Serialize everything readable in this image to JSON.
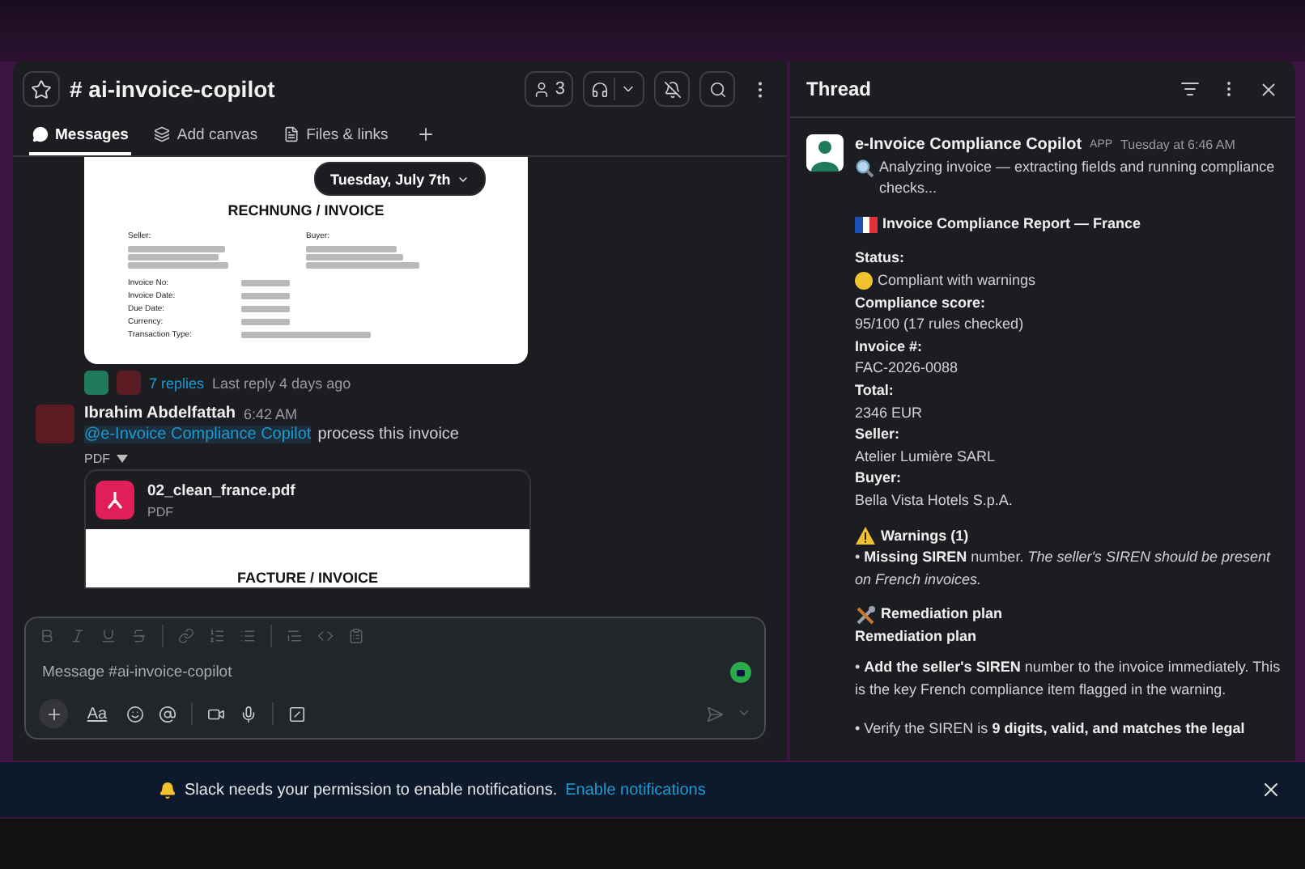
{
  "channel": {
    "title": "# ai-invoice-copilot",
    "member_count": "3"
  },
  "tabs": [
    {
      "label": "Messages",
      "selected": true,
      "kind": "messages"
    },
    {
      "label": "Add canvas",
      "selected": false,
      "kind": "canvas"
    },
    {
      "label": "Files & links",
      "selected": false,
      "kind": "files"
    }
  ],
  "date_divider": "Tuesday, July 7th",
  "invoice_preview": {
    "title": "RECHNUNG / INVOICE",
    "seller_label": "Seller:",
    "buyer_label": "Buyer:",
    "fields": [
      "Invoice No:",
      "Invoice Date:",
      "Due Date:",
      "Currency:",
      "Transaction Type:"
    ]
  },
  "thread_summary": {
    "replies": "7 replies",
    "last_reply": "Last reply 4 days ago"
  },
  "message": {
    "author": "Ibrahim Abdelfattah",
    "time": "6:42 AM",
    "mention": "@e-Invoice Compliance Copilot",
    "text": "process this invoice",
    "attachment_toggle": "PDF",
    "file": {
      "name": "02_clean_france.pdf",
      "type": "PDF",
      "preview_title": "FACTURE / INVOICE"
    }
  },
  "composer": {
    "placeholder": "Message #ai-invoice-copilot",
    "format_toggle": "Aa"
  },
  "thread": {
    "title": "Thread",
    "author": "e-Invoice Compliance Copilot",
    "badge": "APP",
    "time": "Tuesday at 6:46 AM",
    "blocks": [
      {
        "kind": "intro",
        "text": "Analyzing invoice — extracting fields and running compliance checks..."
      },
      {
        "kind": "report-heading",
        "text": "Invoice Compliance Report — France"
      },
      {
        "kind": "label",
        "text": "Status:"
      },
      {
        "kind": "status",
        "color": "#f2c12e",
        "text": "Compliant with warnings"
      },
      {
        "kind": "label",
        "text": "Compliance score:"
      },
      {
        "kind": "value",
        "text": "95/100 (17 rules checked)"
      },
      {
        "kind": "label",
        "text": "Invoice #:"
      },
      {
        "kind": "value",
        "text": "FAC-2026-0088"
      },
      {
        "kind": "label",
        "text": "Total:"
      },
      {
        "kind": "value",
        "text": "2346 EUR"
      },
      {
        "kind": "label",
        "text": "Seller:"
      },
      {
        "kind": "value",
        "text": "Atelier Lumière SARL"
      },
      {
        "kind": "label",
        "text": "Buyer:"
      },
      {
        "kind": "value",
        "text": "Bella Vista Hotels S.p.A."
      },
      {
        "kind": "warning-heading",
        "text": "Warnings (1)"
      },
      {
        "kind": "bullet",
        "text": "• **Missing SIREN** number. *The seller's SIREN should be present on French invoices.*"
      },
      {
        "kind": "tools-heading",
        "text": "Remediation plan"
      },
      {
        "kind": "label",
        "text": "Remediation plan"
      },
      {
        "kind": "bullet",
        "text": "• **Add the seller's SIREN** number to the invoice immediately. This is the key French compliance item flagged in the warning."
      },
      {
        "kind": "bullet-spaced",
        "text": "• Verify the SIREN is **9 digits, valid, and matches the legal**"
      }
    ]
  },
  "banner": {
    "text": "Slack needs your permission to enable notifications.",
    "link": "Enable notifications"
  }
}
